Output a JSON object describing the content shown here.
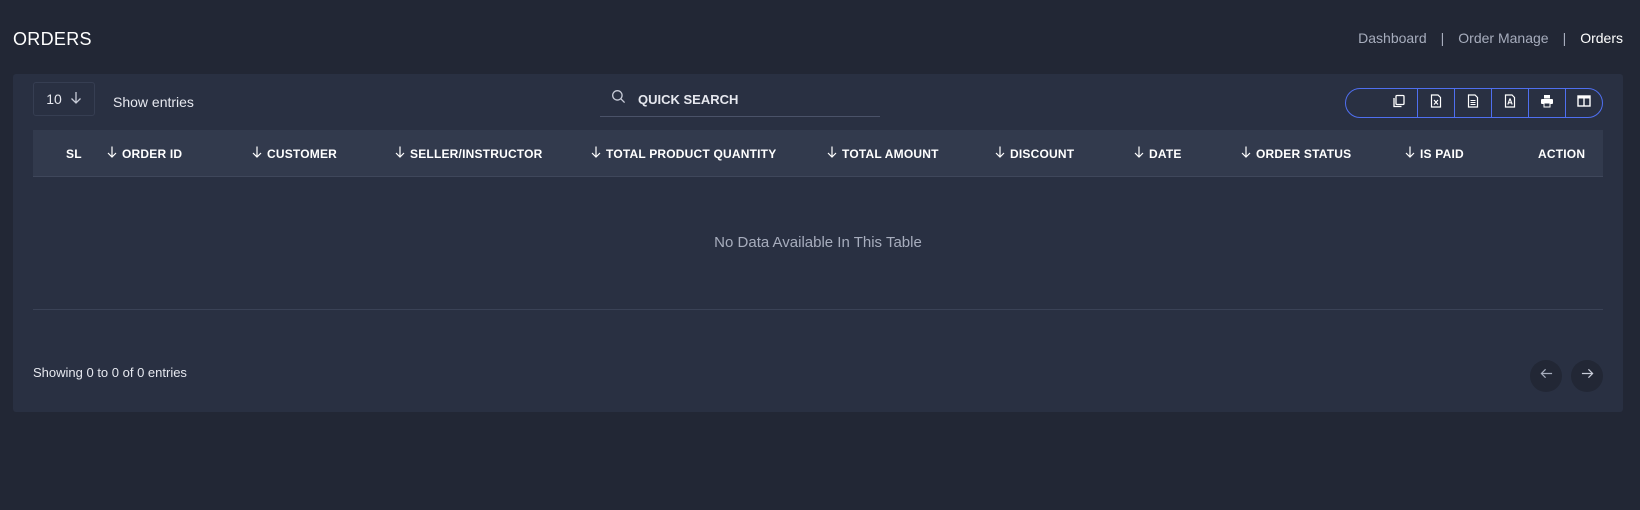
{
  "header": {
    "title": "ORDERS",
    "breadcrumb": [
      {
        "label": "Dashboard"
      },
      {
        "label": "Order Manage"
      },
      {
        "label": "Orders"
      }
    ],
    "separator": "|"
  },
  "controls": {
    "entries_value": "10",
    "show_entries_label": "Show entries",
    "search_placeholder": "QUICK SEARCH",
    "export_buttons": [
      "copy-icon",
      "excel-icon",
      "csv-icon",
      "pdf-icon",
      "print-icon",
      "columns-icon"
    ]
  },
  "table": {
    "columns": [
      "SL",
      "ORDER ID",
      "CUSTOMER",
      "SELLER/INSTRUCTOR",
      "TOTAL PRODUCT QUANTITY",
      "TOTAL AMOUNT",
      "DISCOUNT",
      "DATE",
      "ORDER STATUS",
      "IS PAID",
      "ACTION"
    ],
    "empty_message": "No Data Available In This Table"
  },
  "footer": {
    "info": "Showing 0 to 0 of 0 entries"
  },
  "colors": {
    "background": "#222735",
    "card": "#293042",
    "header_row": "#323a4d",
    "accent": "#4f6ff0"
  }
}
